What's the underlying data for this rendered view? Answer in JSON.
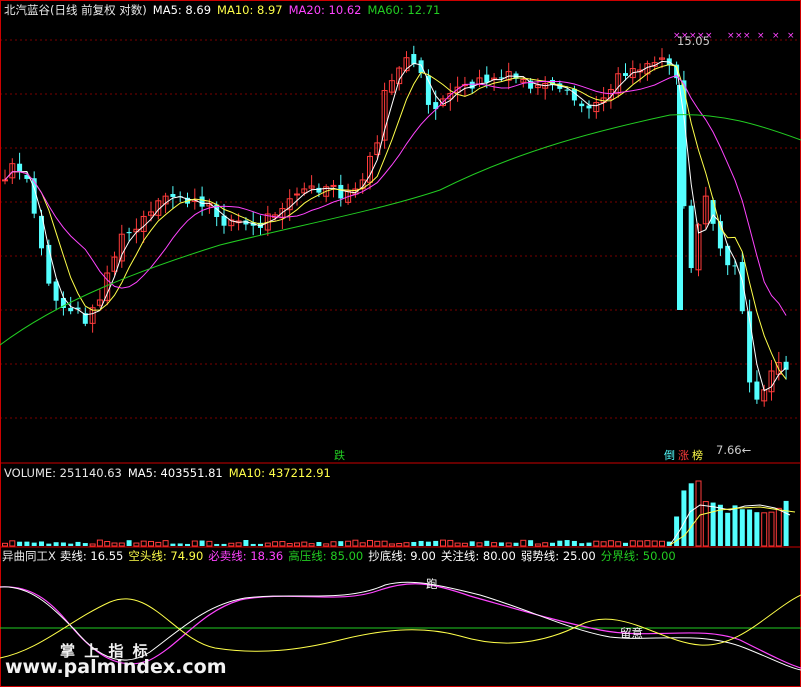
{
  "colors": {
    "background": "#000000",
    "up": "#ff3b3b",
    "down": "#54ffff",
    "ma5": "#ffffff",
    "ma10": "#ffff4a",
    "ma20": "#ff44ff",
    "ma60": "#22cc22",
    "grid": "#7a0000",
    "divider": "#cc0000"
  },
  "price_panel": {
    "title": "北汽蓝谷(日线 前复权 对数)",
    "ma5": {
      "label": "MA5: 8.69"
    },
    "ma10": {
      "label": "MA10: 8.97"
    },
    "ma20": {
      "label": "MA20: 10.62"
    },
    "ma60": {
      "label": "MA60: 12.71"
    },
    "high_marker": "15.05",
    "low_marker": "7.66←",
    "signal_markers": [
      {
        "text": "跌",
        "color": "#22cc22"
      },
      {
        "text": "倒",
        "color": "#54ffff"
      },
      {
        "text": "涨",
        "color": "#ff3b3b"
      },
      {
        "text": "榜",
        "color": "#ffff4a"
      }
    ]
  },
  "volume_panel": {
    "volume": {
      "label": "VOLUME: 251140.63"
    },
    "ma5": {
      "label": "MA5: 403551.81"
    },
    "ma10": {
      "label": "MA10: 437212.91"
    }
  },
  "indicator_panel": {
    "name": {
      "label": "异曲同工X"
    },
    "items": [
      {
        "label": "卖线: 16.55",
        "color": "#ffffff"
      },
      {
        "label": "空头线: 74.90",
        "color": "#ffff4a"
      },
      {
        "label": "必卖线: 18.36",
        "color": "#ff44ff"
      },
      {
        "label": "高压线: 85.00",
        "color": "#22cc22"
      },
      {
        "label": "抄底线: 9.00",
        "color": "#ffffff"
      },
      {
        "label": "关注线: 80.00",
        "color": "#ffffff"
      },
      {
        "label": "弱势线: 25.00",
        "color": "#ffffff"
      },
      {
        "label": "分界线: 50.00",
        "color": "#22cc22"
      }
    ],
    "annotations": {
      "run": "跑",
      "caution": "留意"
    }
  },
  "watermark": {
    "line1": "掌 上 指 标",
    "line2": "www.palmindex.com"
  },
  "chart_data": [
    {
      "type": "candlestick",
      "title": "北汽蓝谷(日线 前复权 对数)",
      "scale": "log",
      "max_label": 15.05,
      "min_label": 7.66,
      "ma_values": {
        "MA5": 8.69,
        "MA10": 8.97,
        "MA20": 10.62,
        "MA60": 12.71
      }
    },
    {
      "type": "bar",
      "title": "VOLUME",
      "values_latest": {
        "VOLUME": 251140.63,
        "MA5": 403551.81,
        "MA10": 437212.91
      }
    },
    {
      "type": "line",
      "title": "异曲同工X",
      "series": [
        {
          "name": "卖线",
          "latest": 16.55
        },
        {
          "name": "空头线",
          "latest": 74.9
        },
        {
          "name": "必卖线",
          "latest": 18.36
        }
      ],
      "reference_lines": {
        "高压线": 85.0,
        "抄底线": 9.0,
        "关注线": 80.0,
        "弱势线": 25.0,
        "分界线": 50.0
      }
    }
  ]
}
